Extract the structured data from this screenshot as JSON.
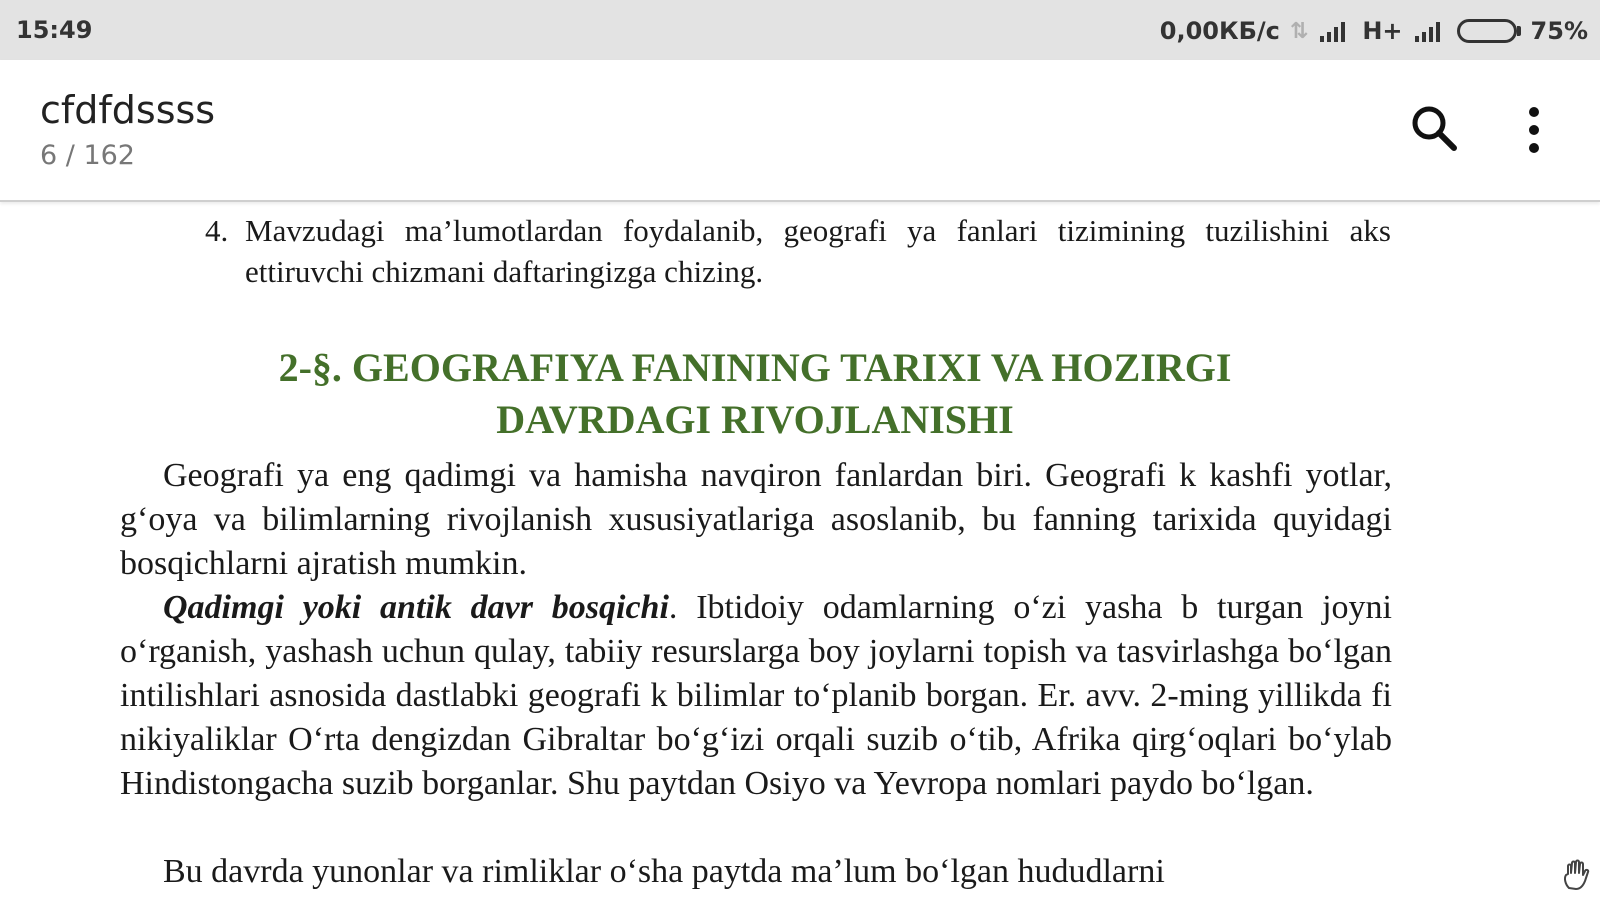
{
  "status": {
    "time": "15:49",
    "speed": "0,00КБ/с",
    "network": "H+",
    "battery": "75%",
    "battery_level": 0.75,
    "icons": [
      "data-transfer-icon",
      "signal-icon",
      "signal-icon",
      "battery-icon"
    ]
  },
  "appbar": {
    "title": "cfdfdssss",
    "page": "6 / 162",
    "icons": [
      "search-icon",
      "more-vert-icon"
    ]
  },
  "document": {
    "question": {
      "number": "4.",
      "text": "Mavzudagi ma’lumotlardan foydalanib, geografi ya fanlari tizimining tuzilishini aks ettiruvchi chizmani daftaringizga chizing."
    },
    "heading_line1": "2-§. GEOGRAFIYA FANINING TARIXI VA HOZIRGI",
    "heading_line2": "DAVRDAGI RIVOJLANISHI",
    "para1": "Geografi ya eng qadimgi va hamisha navqiron fanlardan biri. Geografi k kashfi yotlar, g‘oya va bilimlarning rivojlanish xususiyatlariga asoslanib, bu fanning tarixida quyidagi bosqichlarni ajratish mumkin.",
    "para2_lead": "Qadimgi yoki antik davr bosqichi",
    "para2_rest": ". Ibtidoiy odamlarning o‘zi yasha b turgan joyni o‘rganish, yashash uchun qulay, tabiiy resurslarga boy joylarni topish va tasvirlashga bo‘lgan intilishlari asnosida dastlabki geografi k bilimlar to‘planib borgan. Er. avv. 2-ming yillikda fi nikiyaliklar O‘rta dengizdan Gibraltar bo‘g‘izi orqali suzib o‘tib, Afrika qirg‘oqlari bo‘ylab Hindistongacha suzib borganlar. Shu paytdan Osiyo va Yevropa nomlari paydo bo‘lgan.",
    "para3": "Bu davrda yunonlar va rimliklar o‘sha paytda ma’lum bo‘lgan hududlarni"
  },
  "accent_color": "#44702a",
  "floating_icon": "hand-icon"
}
